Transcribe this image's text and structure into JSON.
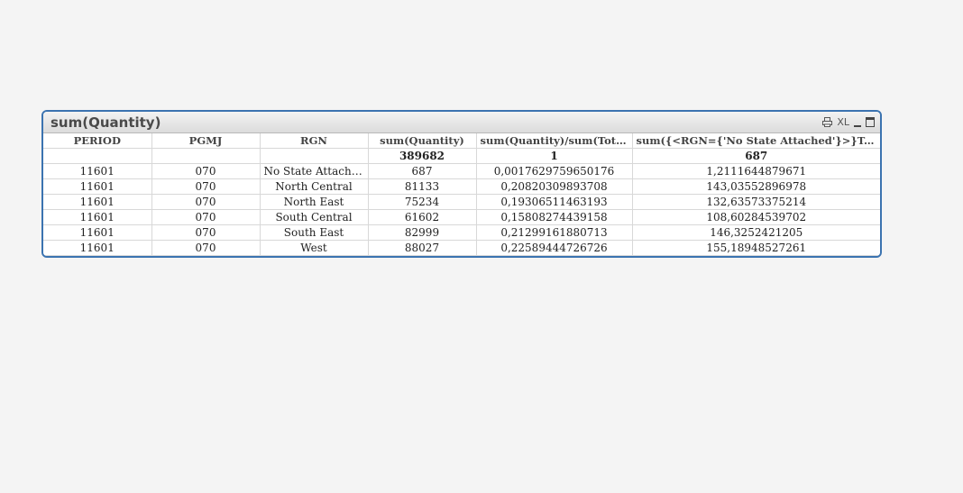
{
  "window": {
    "title": "sum(Quantity)",
    "icons": {
      "print": "print-icon",
      "xl_label": "XL",
      "minimize": "minimize-icon",
      "maximize": "maximize-icon"
    }
  },
  "table": {
    "columns": [
      "PERIOD",
      "PGMJ",
      "RGN",
      "sum(Quantity)",
      "sum(Quantity)/sum(Total...",
      "sum({<RGN={'No  State  Attached'}>}Total  ..."
    ],
    "totals": [
      "",
      "",
      "",
      "389682",
      "1",
      "687"
    ],
    "rows": [
      [
        "11601",
        "070",
        "No State Attached",
        "687",
        "0,0017629759650176",
        "1,2111644879671"
      ],
      [
        "11601",
        "070",
        "North Central",
        "81133",
        "0,20820309893708",
        "143,03552896978"
      ],
      [
        "11601",
        "070",
        "North East",
        "75234",
        "0,19306511463193",
        "132,63573375214"
      ],
      [
        "11601",
        "070",
        "South Central",
        "61602",
        "0,15808274439158",
        "108,60284539702"
      ],
      [
        "11601",
        "070",
        "South East",
        "82999",
        "0,21299161880713",
        "146,3252421205"
      ],
      [
        "11601",
        "070",
        "West",
        "88027",
        "0,22589444726726",
        "155,18948527261"
      ]
    ]
  },
  "colors": {
    "frame_border": "#3b73b0",
    "background": "#f4f4f4"
  }
}
